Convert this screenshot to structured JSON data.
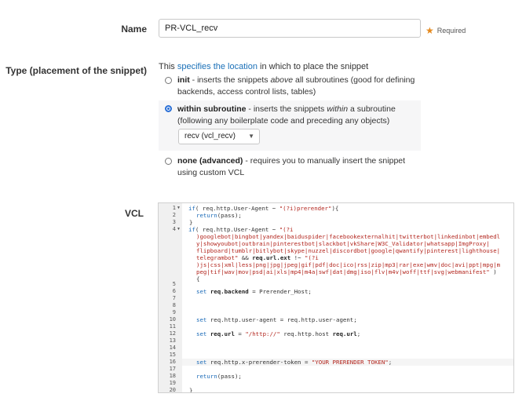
{
  "name": {
    "label": "Name",
    "value": "PR-VCL_recv",
    "required": "Required"
  },
  "type": {
    "label": "Type (placement of the snippet)",
    "intro_prefix": "This ",
    "intro_link": "specifies the location",
    "intro_suffix": " in which to place the snippet",
    "options": [
      {
        "title": "init",
        "desc_1": " - inserts the snippets ",
        "emph": "above",
        "desc_2": " all subroutines (good for defining backends, access control lists, tables)",
        "selected": false
      },
      {
        "title": "within subroutine",
        "desc_1": " - inserts the snippets ",
        "emph": "within",
        "desc_2": " a subroutine (following any boilerplate code and preceding any objects)",
        "selected": true
      },
      {
        "title": "none (advanced)",
        "desc_1": " - requires you to manually insert the snippet using custom VCL",
        "emph": "",
        "desc_2": "",
        "selected": false
      }
    ],
    "subroutine_select": "recv (vcl_recv)"
  },
  "vcl": {
    "label": "VCL",
    "line_numbers": [
      "1",
      "2",
      "3",
      "4",
      "5",
      "6",
      "7",
      "8",
      "9",
      "10",
      "11",
      "12",
      "13",
      "14",
      "15",
      "16",
      "17",
      "18",
      "19",
      "20"
    ],
    "code": {
      "l1_kw": "if",
      "l1_a": "( req.http.User-Agent ~ ",
      "l1_str": "\"(?i)prerender\"",
      "l1_b": "){",
      "l2_kw": "return",
      "l2_a": "(pass);",
      "l3": "}",
      "l4_kw": "if",
      "l4_a": "( req.http.User-Agent ~ ",
      "l4_str": "\"(?i",
      "l4_w1": ")googlebot|bingbot|yandex|baiduspider|facebookexternalhit|twitterbot|linkedinbot|embedl",
      "l4_w2": "y|showyoubot|outbrain|pinterestbot|slackbot|vkShare|W3C_Validator|whatsapp|ImgProxy|",
      "l4_w3": "flipboard|tumblr|bitlybot|skype|nuzzel|discordbot|google|qwantify|pinterest|lighthouse|",
      "l4_w4": "telegrambot\"",
      "l4_amp": " && ",
      "l4_ext": "req.url.ext",
      "l4_op": " !~ ",
      "l4_str2": "\"(?i",
      "l4_w5": ")js|css|xml|less|png|jpg|jpeg|gif|pdf|doc|ico|rss|zip|mp3|rar|exe|wmv|doc|avi|ppt|mpg|m",
      "l4_w6": "peg|tif|wav|mov|psd|ai|xls|mp4|m4a|swf|dat|dmg|iso|flv|m4v|woff|ttf|svg|webmanifest\"",
      "l4_end": " )",
      "l4_brace": "{",
      "l6_kw": "set",
      "l6_bd": "req.backend",
      "l6_a": " = Prerender_Host;",
      "l10_kw": "set",
      "l10_a": " req.http.user-agent = req.http.user-agent;",
      "l12_kw": "set",
      "l12_bd": "req.url",
      "l12_a": " = ",
      "l12_str": "\"/http://\"",
      "l12_b": " req.http.host ",
      "l12_bd2": "req.url",
      "l12_c": ";",
      "l16_kw": "set",
      "l16_a": " req.http.x-prerender-token = ",
      "l16_str": "\"YOUR PRERENDER TOKEN\"",
      "l16_b": ";",
      "l18_kw": "return",
      "l18_a": "(pass);",
      "l20": "}"
    }
  }
}
